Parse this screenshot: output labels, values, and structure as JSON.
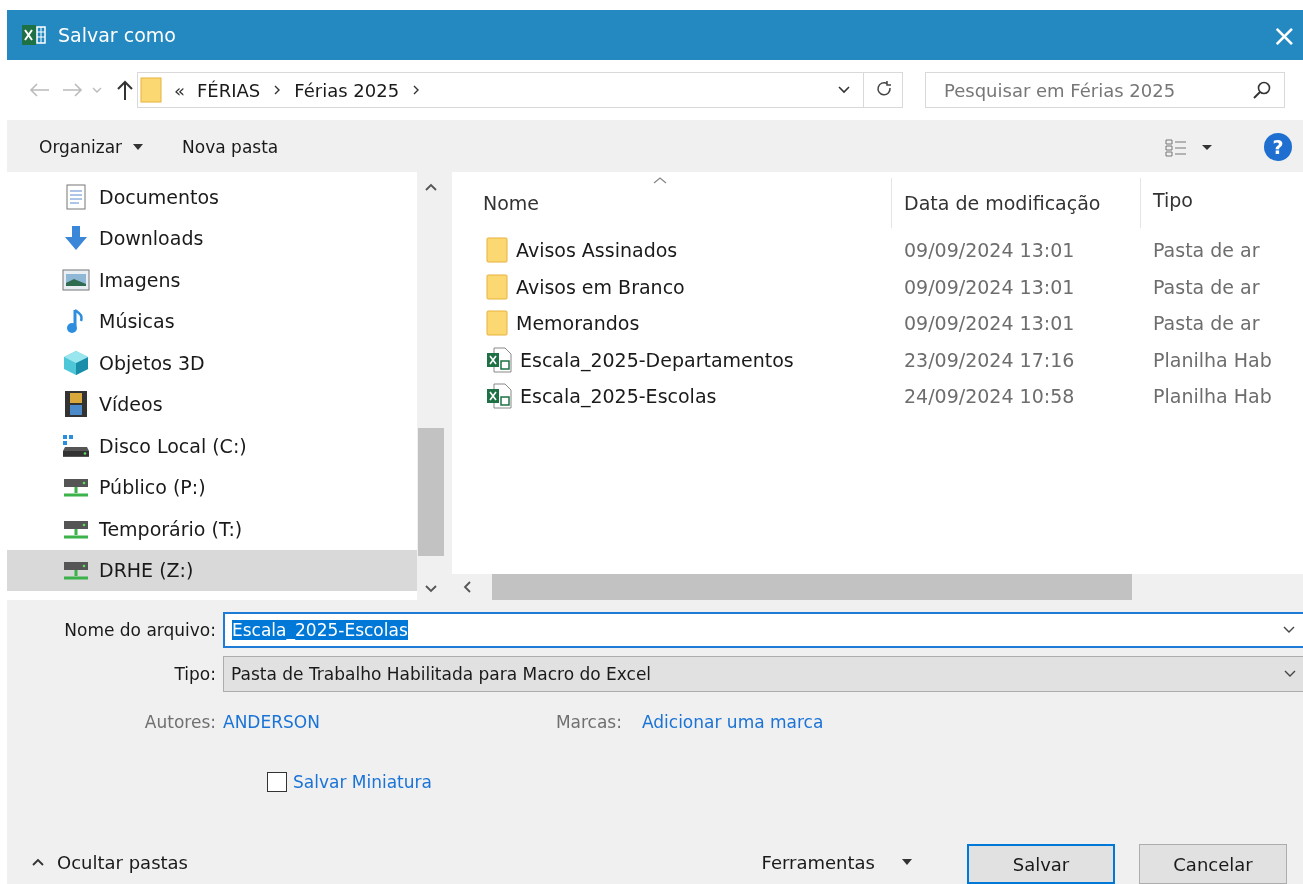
{
  "window": {
    "title": "Salvar como",
    "close": "×"
  },
  "nav": {
    "overflow": "«",
    "breadcrumb": [
      "FÉRIAS",
      "Férias 2025"
    ],
    "search": {
      "placeholder": "Pesquisar em Férias 2025"
    }
  },
  "toolbar": {
    "organize": "Organizar",
    "new_folder": "Nova pasta",
    "help": "?"
  },
  "sidebar": {
    "items": [
      {
        "label": "Documentos",
        "kind": "documents",
        "selected": false
      },
      {
        "label": "Downloads",
        "kind": "downloads",
        "selected": false
      },
      {
        "label": "Imagens",
        "kind": "pictures",
        "selected": false
      },
      {
        "label": "Músicas",
        "kind": "music",
        "selected": false
      },
      {
        "label": "Objetos 3D",
        "kind": "objects3d",
        "selected": false
      },
      {
        "label": "Vídeos",
        "kind": "videos",
        "selected": false
      },
      {
        "label": "Disco Local (C:)",
        "kind": "local-disk",
        "selected": false
      },
      {
        "label": "Público (P:)",
        "kind": "network-drive",
        "selected": false
      },
      {
        "label": "Temporário (T:)",
        "kind": "network-drive",
        "selected": false
      },
      {
        "label": "DRHE (Z:)",
        "kind": "network-drive",
        "selected": true
      }
    ]
  },
  "table": {
    "columns": [
      "Nome",
      "Data de modificação",
      "Tipo"
    ],
    "rows": [
      {
        "kind": "folder",
        "name": "Avisos Assinados",
        "date": "09/09/2024 13:01",
        "type": "Pasta de ar"
      },
      {
        "kind": "folder",
        "name": "Avisos em Branco",
        "date": "09/09/2024 13:01",
        "type": "Pasta de ar"
      },
      {
        "kind": "folder",
        "name": "Memorandos",
        "date": "09/09/2024 13:01",
        "type": "Pasta de ar"
      },
      {
        "kind": "excel",
        "name": "Escala_2025-Departamentos",
        "date": "23/09/2024 17:16",
        "type": "Planilha Hab"
      },
      {
        "kind": "excel",
        "name": "Escala_2025-Escolas",
        "date": "24/09/2024 10:58",
        "type": "Planilha Hab"
      }
    ]
  },
  "form": {
    "filename": {
      "label": "Nome do arquivo:",
      "value": "Escala_2025-Escolas",
      "selected": true
    },
    "type": {
      "label": "Tipo:",
      "value": "Pasta de Trabalho Habilitada para Macro do Excel"
    },
    "authors": {
      "label": "Autores:",
      "value": "ANDERSON"
    },
    "tags": {
      "label": "Marcas:",
      "value": "Adicionar uma marca"
    },
    "thumbnail": {
      "label": "Salvar Miniatura",
      "checked": false
    }
  },
  "footer": {
    "hide_folders": "Ocultar pastas",
    "tools": "Ferramentas",
    "save": "Salvar",
    "cancel": "Cancelar"
  }
}
